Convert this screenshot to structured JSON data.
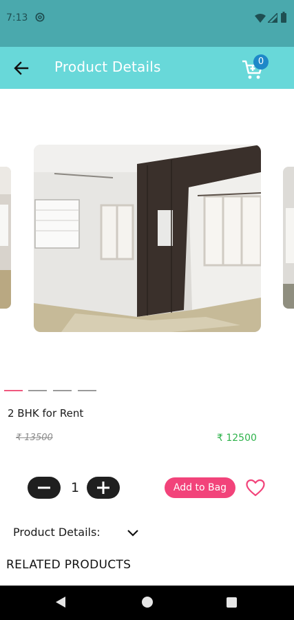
{
  "status_bar": {
    "time": "7:13",
    "icons": [
      "at-sign-icon",
      "wifi-icon",
      "signal-icon",
      "battery-icon"
    ]
  },
  "app_bar": {
    "title": "Product Details",
    "back_icon": "arrow-left-icon",
    "cart_icon": "shopping-cart-icon",
    "cart_count": "0",
    "background": "#68d8d9"
  },
  "carousel": {
    "slide_count": 4,
    "active_index": 0,
    "active_color": "#f0587e"
  },
  "product": {
    "name": "2 BHK for Rent",
    "old_price": "₹ 13500",
    "price": "₹ 12500",
    "quantity": "1",
    "add_to_bag_label": "Add to Bag",
    "price_color": "#2db24a",
    "accent": "#f2437a"
  },
  "details": {
    "label": "Product Details:",
    "chevron_icon": "chevron-down-icon"
  },
  "related": {
    "heading": "RELATED PRODUCTS"
  },
  "nav": {
    "icons": [
      "nav-back-icon",
      "nav-home-icon",
      "nav-recents-icon"
    ]
  }
}
